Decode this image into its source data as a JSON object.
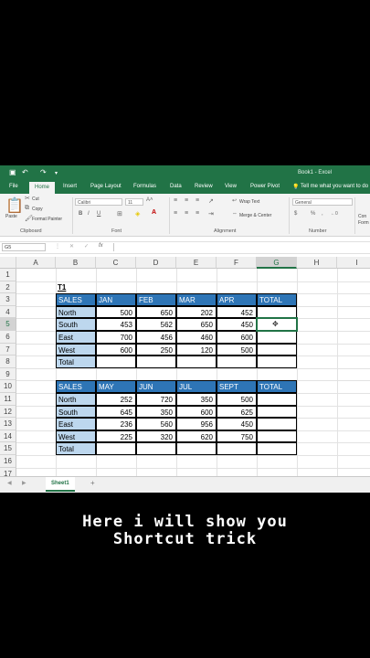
{
  "window": {
    "title": "Book1 - Excel"
  },
  "ribbon_tabs": [
    "File",
    "Home",
    "Insert",
    "Page Layout",
    "Formulas",
    "Data",
    "Review",
    "View",
    "Power Pivot",
    "Tell me what you want to do"
  ],
  "ribbon": {
    "clipboard": {
      "paste": "Paste",
      "cut": "Cut",
      "copy": "Copy",
      "format_painter": "Format Painter",
      "label": "Clipboard"
    },
    "font": {
      "name": "Calibri",
      "size": "11",
      "label": "Font",
      "bold": "B",
      "italic": "I",
      "underline": "U"
    },
    "alignment": {
      "wrap": "Wrap Text",
      "merge": "Merge & Center",
      "label": "Alignment"
    },
    "number": {
      "format": "General",
      "label": "Number",
      "currency": "$",
      "percent": "%",
      "comma": ","
    },
    "styles": {
      "conditional": "Con",
      "format": "Form"
    }
  },
  "formula_bar": {
    "name_box": "G5",
    "cancel": "✕",
    "enter": "✓",
    "fx": "fx",
    "value": ""
  },
  "columns": [
    "A",
    "B",
    "C",
    "D",
    "E",
    "F",
    "G",
    "H",
    "I"
  ],
  "rows": [
    "1",
    "2",
    "3",
    "4",
    "5",
    "6",
    "7",
    "8",
    "9",
    "10",
    "11",
    "12",
    "13",
    "14",
    "15",
    "16",
    "17"
  ],
  "sheet": {
    "t1_label": "T1",
    "table1": {
      "headers": [
        "SALES",
        "JAN",
        "FEB",
        "MAR",
        "APR",
        "TOTAL"
      ],
      "rows": [
        {
          "region": "North",
          "vals": [
            "500",
            "650",
            "202",
            "452"
          ]
        },
        {
          "region": "South",
          "vals": [
            "453",
            "562",
            "650",
            "450"
          ]
        },
        {
          "region": "East",
          "vals": [
            "700",
            "456",
            "460",
            "600"
          ]
        },
        {
          "region": "West",
          "vals": [
            "600",
            "250",
            "120",
            "500"
          ]
        }
      ],
      "total_label": "Total"
    },
    "table2": {
      "headers": [
        "SALES",
        "MAY",
        "JUN",
        "JUL",
        "SEPT",
        "TOTAL"
      ],
      "rows": [
        {
          "region": "North",
          "vals": [
            "252",
            "720",
            "350",
            "500"
          ]
        },
        {
          "region": "South",
          "vals": [
            "645",
            "350",
            "600",
            "625"
          ]
        },
        {
          "region": "East",
          "vals": [
            "236",
            "560",
            "956",
            "450"
          ]
        },
        {
          "region": "West",
          "vals": [
            "225",
            "320",
            "620",
            "750"
          ]
        }
      ],
      "total_label": "Total"
    }
  },
  "sheet_tabs": {
    "active": "Sheet1",
    "add": "+"
  },
  "caption": {
    "line1": "Here i will show you",
    "line2": "Shortcut trick"
  },
  "colors": {
    "excel_green": "#217346",
    "header_blue": "#2e75b6",
    "label_blue": "#bdd7ee"
  }
}
